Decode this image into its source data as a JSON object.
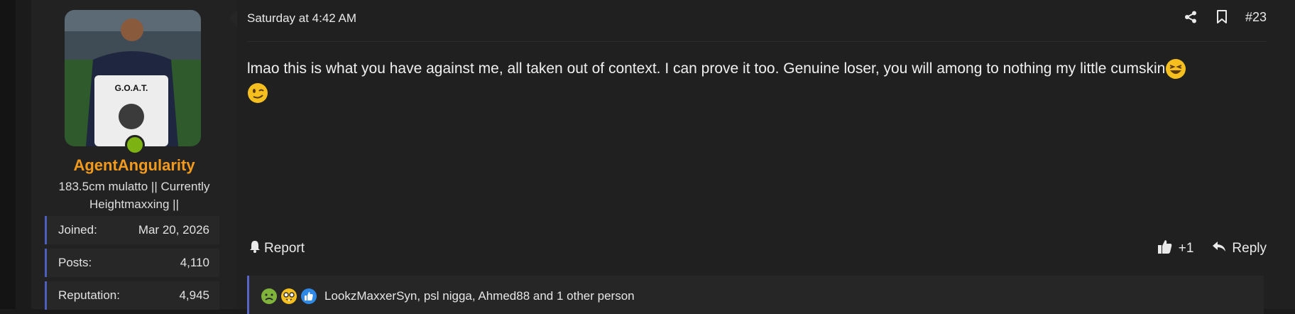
{
  "post": {
    "timestamp": "Saturday at 4:42 AM",
    "number": "#23",
    "body": "lmao this is what you have against me, all taken out of context. I can prove it too. Genuine loser, you will among to nothing my little cumskin",
    "report_label": "Report",
    "like_count": "+1",
    "reply_label": "Reply",
    "reactions_text": "LookzMaxxerSyn, psl nigga, Ahmed88 and 1 other person"
  },
  "user": {
    "name": "AgentAngularity",
    "title": "183.5cm mulatto || Currently Heightmaxxing ||",
    "avatar_shirt_text": "G.O.A.T.",
    "stats": [
      {
        "label": "Joined:",
        "value": "Mar 20, 2026"
      },
      {
        "label": "Posts:",
        "value": "4,110"
      },
      {
        "label": "Reputation:",
        "value": "4,945"
      }
    ]
  },
  "colors": {
    "username": "#f29a1d",
    "online": "#7cb313",
    "stat_accent": "#4c5fbd"
  },
  "icons": {
    "header": [
      "share-icon",
      "bookmark-icon"
    ],
    "emoji": [
      "laughing-squint-emoji",
      "winking-emoji"
    ],
    "reactions": [
      "nauseated-emoji",
      "nerd-emoji",
      "like-reaction-icon"
    ]
  }
}
